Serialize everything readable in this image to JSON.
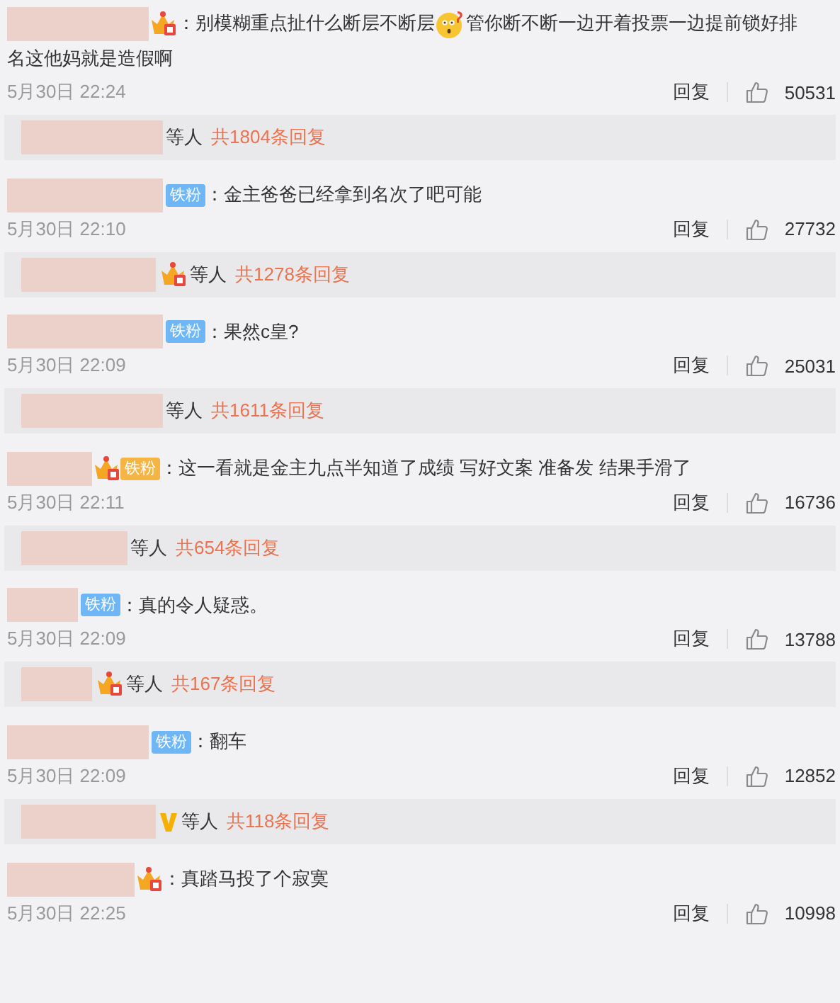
{
  "comments": [
    {
      "badges": [
        {
          "kind": "crown"
        }
      ],
      "parts": [
        {
          "kind": "text",
          "text": "：别模糊重点扯什么断层不断层"
        },
        {
          "kind": "emoji"
        },
        {
          "kind": "text",
          "text": "管你断不断一边开着投票一边提前锁好排"
        },
        {
          "kind": "text",
          "text": "名这他妈就是造假啊"
        }
      ],
      "time": "5月30日 22:24",
      "reply": "回复",
      "likes": "50531",
      "thread": {
        "suffix": "等人",
        "count": "共1804条回复"
      }
    },
    {
      "badges": [
        {
          "kind": "fan",
          "label": "铁粉"
        }
      ],
      "parts": [
        {
          "kind": "text",
          "text": "：金主爸爸已经拿到名次了吧可能"
        }
      ],
      "time": "5月30日 22:10",
      "reply": "回复",
      "likes": "27732",
      "thread": {
        "badges": [
          {
            "kind": "crown"
          }
        ],
        "suffix": "等人",
        "count": "共1278条回复"
      }
    },
    {
      "badges": [
        {
          "kind": "fan",
          "label": "铁粉"
        }
      ],
      "parts": [
        {
          "kind": "text",
          "text": "：果然c皇?"
        }
      ],
      "time": "5月30日 22:09",
      "reply": "回复",
      "likes": "25031",
      "thread": {
        "suffix": "等人",
        "count": "共1611条回复"
      }
    },
    {
      "badges": [
        {
          "kind": "crown_fan",
          "label": "铁粉"
        }
      ],
      "parts": [
        {
          "kind": "text",
          "text": "：这一看就是金主九点半知道了成绩 写好文案 准备发 结果手滑了"
        }
      ],
      "time": "5月30日 22:11",
      "reply": "回复",
      "likes": "16736",
      "thread": {
        "suffix": "等人",
        "count": "共654条回复"
      }
    },
    {
      "badges": [
        {
          "kind": "fan",
          "label": "铁粉"
        }
      ],
      "parts": [
        {
          "kind": "text",
          "text": "：真的令人疑惑。"
        }
      ],
      "time": "5月30日 22:09",
      "reply": "回复",
      "likes": "13788",
      "thread": {
        "badges": [
          {
            "kind": "crown"
          }
        ],
        "suffix": "等人",
        "count": "共167条回复"
      }
    },
    {
      "badges": [
        {
          "kind": "fan",
          "label": "铁粉"
        }
      ],
      "parts": [
        {
          "kind": "text",
          "text": "：翻车"
        }
      ],
      "time": "5月30日 22:09",
      "reply": "回复",
      "likes": "12852",
      "thread": {
        "badges": [
          {
            "kind": "vip"
          }
        ],
        "suffix": "等人",
        "count": "共118条回复"
      }
    },
    {
      "badges": [
        {
          "kind": "crown"
        }
      ],
      "parts": [
        {
          "kind": "text",
          "text": "：真踏马投了个寂寞"
        }
      ],
      "time": "5月30日 22:25",
      "reply": "回复",
      "likes": "10998"
    }
  ]
}
